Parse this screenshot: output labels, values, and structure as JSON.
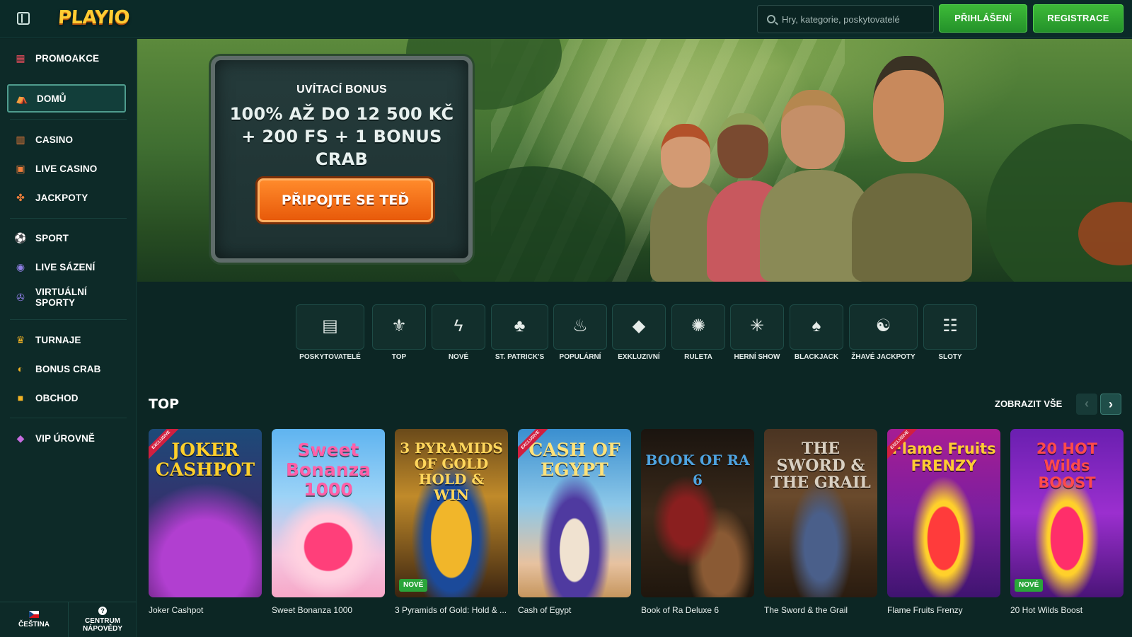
{
  "header": {
    "logo": "PLAYIO",
    "search_placeholder": "Hry, kategorie, poskytovatelé",
    "login": "PŘIHLÁŠENÍ",
    "register": "REGISTRACE"
  },
  "sidebar": {
    "items": [
      {
        "label": "PROMOAKCE",
        "icon": "gift-icon"
      },
      {
        "label": "DOMŮ",
        "icon": "home-icon",
        "active": true
      },
      {
        "label": "CASINO",
        "icon": "casino-icon"
      },
      {
        "label": "LIVE CASINO",
        "icon": "live-casino-icon"
      },
      {
        "label": "JACKPOTY",
        "icon": "clover-icon"
      },
      {
        "label": "SPORT",
        "icon": "football-icon"
      },
      {
        "label": "LIVE SÁZENÍ",
        "icon": "live-betting-icon"
      },
      {
        "label": "VIRTUÁLNÍ SPORTY",
        "icon": "gamepad-icon"
      },
      {
        "label": "TURNAJE",
        "icon": "trophy-icon"
      },
      {
        "label": "BONUS CRAB",
        "icon": "crab-icon"
      },
      {
        "label": "OBCHOD",
        "icon": "shop-bag-icon"
      },
      {
        "label": "VIP ÚROVNĚ",
        "icon": "diamond-icon"
      }
    ],
    "footer": {
      "language": "ČEŠTINA",
      "help": "CENTRUM NÁPOVĚDY"
    }
  },
  "banner": {
    "subtitle": "UVÍTACÍ BONUS",
    "title": "100% AŽ DO 12 500 KČ + 200 FS + 1 BONUS CRAB",
    "cta": "PŘIPOJTE SE TEĎ"
  },
  "categories": [
    {
      "label": "POSKYTOVATELÉ",
      "icon": "providers-icon"
    },
    {
      "label": "TOP",
      "icon": "fleur-de-lis-icon"
    },
    {
      "label": "NOVÉ",
      "icon": "lightning-icon"
    },
    {
      "label": "ST. PATRICK'S",
      "icon": "leprechaun-hat-icon"
    },
    {
      "label": "POPULÁRNÍ",
      "icon": "flame-icon"
    },
    {
      "label": "EXKLUZIVNÍ",
      "icon": "diamond-icon"
    },
    {
      "label": "RULETA",
      "icon": "roulette-icon"
    },
    {
      "label": "HERNÍ SHOW",
      "icon": "wheel-icon"
    },
    {
      "label": "BLACKJACK",
      "icon": "spade-icon"
    },
    {
      "label": "ŽHAVÉ JACKPOTY",
      "icon": "hot-jackpot-icon"
    },
    {
      "label": "SLOTY",
      "icon": "slot-777-icon"
    }
  ],
  "games_section": {
    "title": "TOP",
    "see_all": "ZOBRAZIT VŠE",
    "prev": "‹",
    "next": "›",
    "games": [
      {
        "name": "Joker Cashpot",
        "logo": "JOKER CASHPOT",
        "exclusive": true,
        "new": false
      },
      {
        "name": "Sweet Bonanza 1000",
        "logo": "Sweet Bonanza 1000",
        "exclusive": false,
        "new": false
      },
      {
        "name": "3 Pyramids of Gold: Hold & ...",
        "logo": "3 PYRAMIDS OF GOLD HOLD & WIN",
        "exclusive": false,
        "new": true,
        "new_label": "NOVÉ"
      },
      {
        "name": "Cash of Egypt",
        "logo": "CASH OF EGYPT",
        "exclusive": true,
        "new": false
      },
      {
        "name": "Book of Ra Deluxe 6",
        "logo": "BOOK OF RA 6",
        "exclusive": false,
        "new": false
      },
      {
        "name": "The Sword & the Grail",
        "logo": "THE SWORD & THE GRAIL",
        "exclusive": false,
        "new": false
      },
      {
        "name": "Flame Fruits Frenzy",
        "logo": "Flame Fruits FRENZY",
        "exclusive": true,
        "new": false
      },
      {
        "name": "20 Hot Wilds Boost",
        "logo": "20 HOT Wilds BOOST",
        "exclusive": false,
        "new": true,
        "new_label": "NOVÉ"
      }
    ],
    "exclusive_label": "EXCLUSIVE"
  },
  "colors": {
    "background": "#0c2624",
    "accent_green": "#2fa833",
    "cta_orange": "#f07418",
    "sidebar_active_border": "#4f9c8e"
  }
}
